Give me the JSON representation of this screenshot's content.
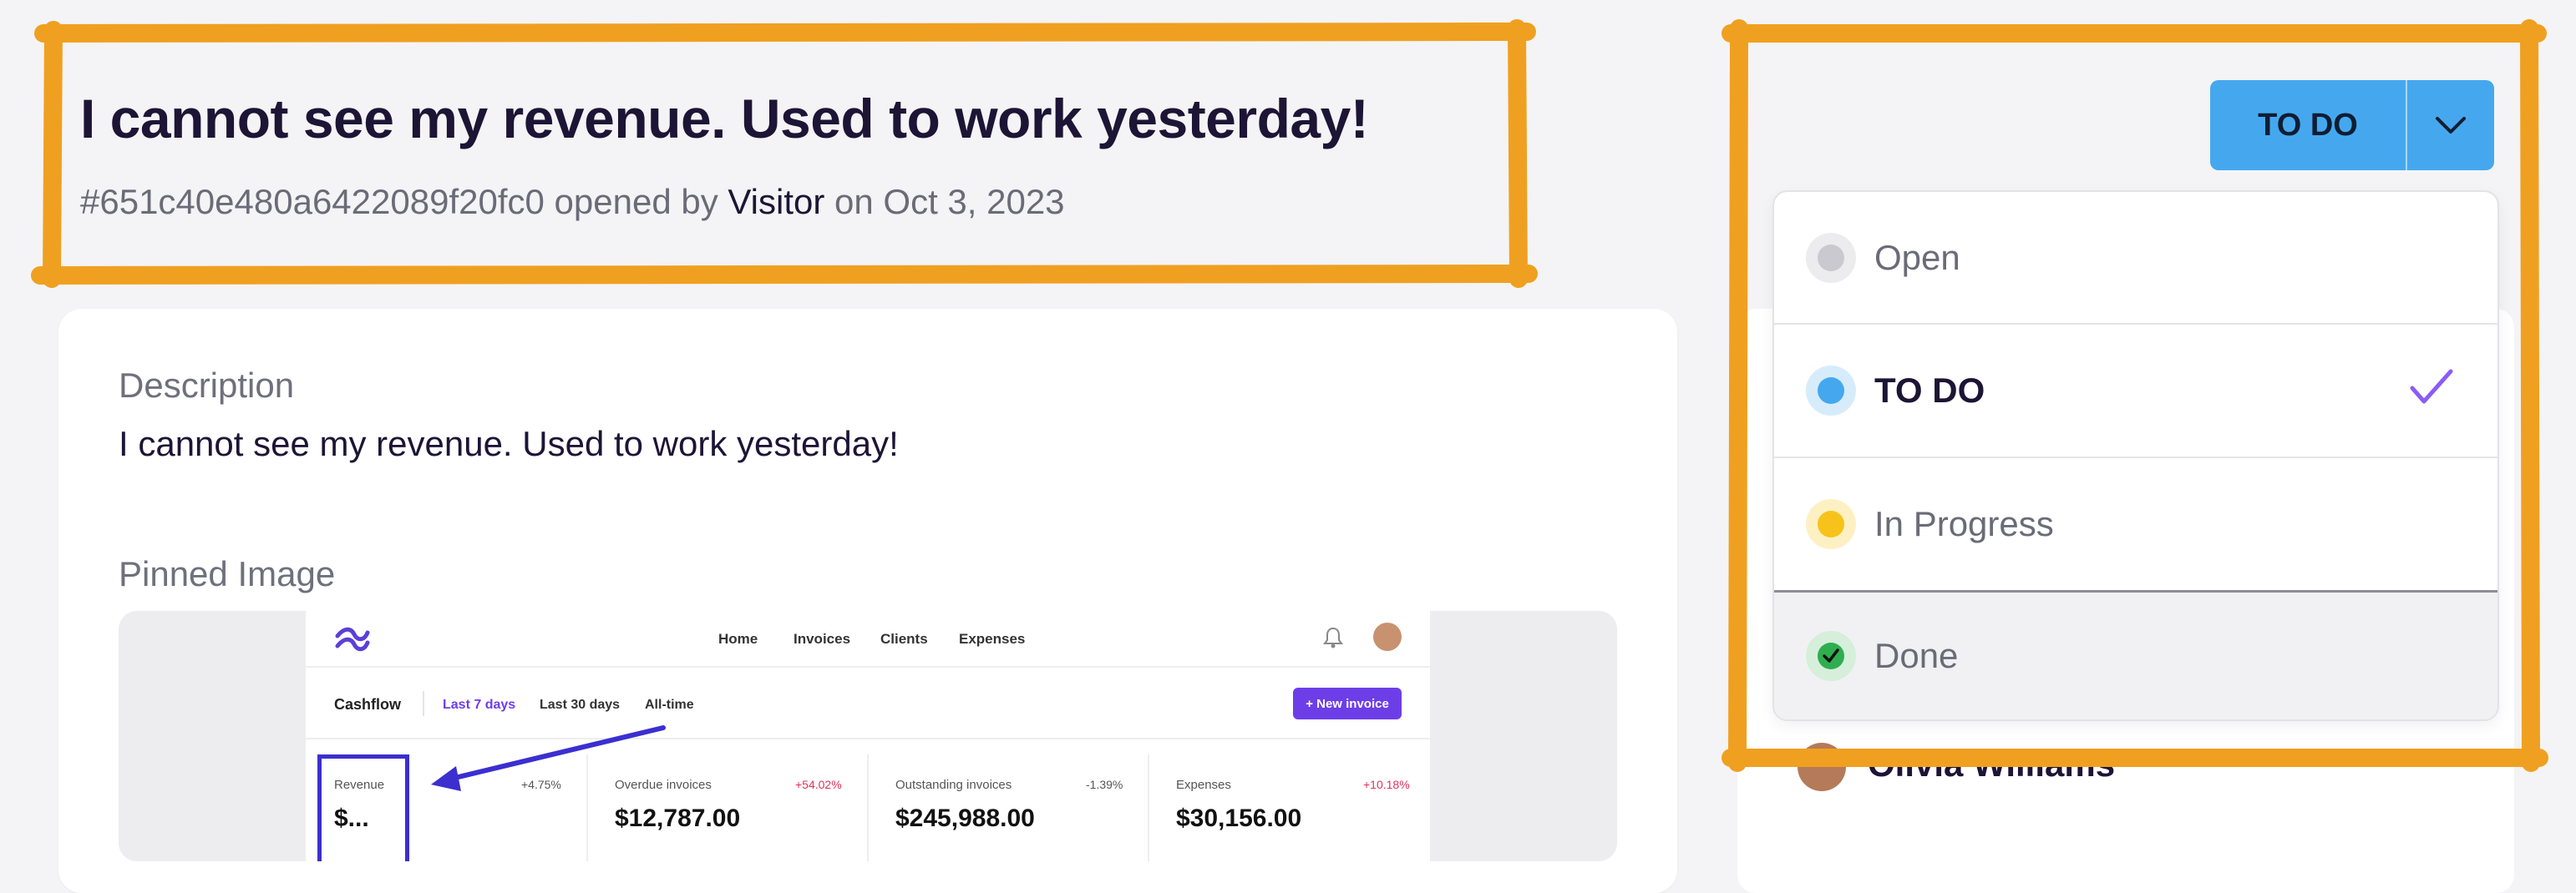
{
  "header": {
    "title": "I cannot see my revenue. Used to work yesterday!",
    "ticket_id": "#651c40e480a6422089f20fc0",
    "opened_by_text": "opened by",
    "author": "Visitor",
    "date_text": "on Oct 3, 2023"
  },
  "card": {
    "description_label": "Description",
    "description_text": "I cannot see my revenue. Used to work yesterday!",
    "pinned_label": "Pinned Image"
  },
  "pinned_screenshot": {
    "nav": [
      "Home",
      "Invoices",
      "Clients",
      "Expenses"
    ],
    "cashflow_label": "Cashflow",
    "ranges": [
      "Last 7 days",
      "Last 30 days",
      "All-time"
    ],
    "new_invoice_label": "+ New invoice",
    "stats": [
      {
        "label": "Revenue",
        "change": "+4.75%",
        "value": "$..."
      },
      {
        "label": "Overdue invoices",
        "change": "+54.02%",
        "value": "$12,787.00"
      },
      {
        "label": "Outstanding invoices",
        "change": "-1.39%",
        "value": "$245,988.00"
      },
      {
        "label": "Expenses",
        "change": "+10.18%",
        "value": "$30,156.00"
      }
    ]
  },
  "status": {
    "current": "TO DO",
    "options": [
      {
        "label": "Open",
        "color": "#c9c9cf",
        "halo": "#ececef",
        "selected": false
      },
      {
        "label": "TO DO",
        "color": "#45a8ee",
        "halo": "#d6ecfb",
        "selected": true
      },
      {
        "label": "In Progress",
        "color": "#f7c31a",
        "halo": "#fdf1c4",
        "selected": false
      },
      {
        "label": "Done",
        "color": "#2fae4f",
        "halo": "#d5efdb",
        "selected": false
      }
    ]
  },
  "assignee": {
    "name": "Olivia Williams"
  },
  "colors": {
    "accent": "#7c3aed",
    "status_button": "#45a8ee",
    "annotation": "#f0a020"
  }
}
